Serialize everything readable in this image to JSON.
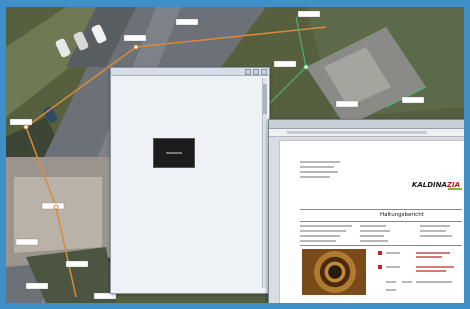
{
  "popup": {
    "title": "",
    "rows": [
      "",
      "",
      "",
      "",
      "",
      "",
      "",
      "",
      "",
      "",
      "",
      "",
      "",
      "",
      "",
      "",
      "",
      "",
      "",
      "",
      "",
      "",
      "",
      "",
      "",
      "",
      "",
      "",
      "",
      "",
      "",
      ""
    ]
  },
  "viewer": {
    "title": "",
    "report_heading": "Haltungsbericht",
    "logo_text": "KALDINA",
    "logo_accent": "ZIA"
  },
  "map_labels": [
    "",
    "",
    "",
    "",
    "",
    "",
    "",
    "",
    "",
    "",
    "",
    ""
  ],
  "colors": {
    "frame": "#3f8fc8",
    "pipe_line": "#d98a3a",
    "label_bg": "#ffffff",
    "logo_red": "#c0161c",
    "logo_green": "#7dbb2f"
  }
}
